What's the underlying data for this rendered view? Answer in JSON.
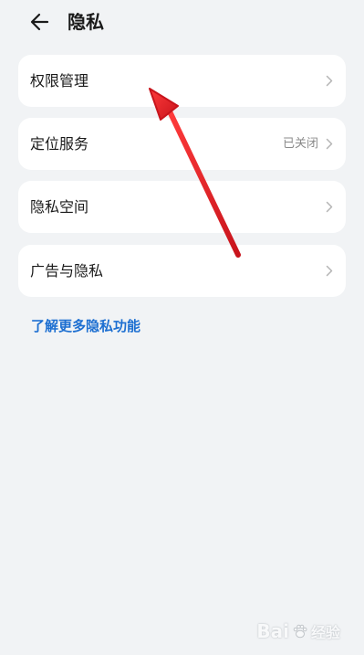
{
  "header": {
    "back_icon": "arrow-left-icon",
    "title": "隐私"
  },
  "menu": {
    "items": [
      {
        "label": "权限管理",
        "status": "",
        "icon": "chevron-right-icon"
      },
      {
        "label": "定位服务",
        "status": "已关闭",
        "icon": "chevron-right-icon"
      },
      {
        "label": "隐私空间",
        "status": "",
        "icon": "chevron-right-icon"
      },
      {
        "label": "广告与隐私",
        "status": "",
        "icon": "chevron-right-icon"
      }
    ]
  },
  "link": {
    "label": "了解更多隐私功能"
  },
  "annotation": {
    "icon": "red-arrow-annotation",
    "color": "#e0222a"
  },
  "watermark": {
    "brand": "Bai",
    "suffix": "经验",
    "icon": "baidu-paw-icon"
  },
  "colors": {
    "background": "#f1f3f5",
    "card": "#ffffff",
    "accent": "#1d6fd1",
    "status_text": "#8a8a8a"
  }
}
